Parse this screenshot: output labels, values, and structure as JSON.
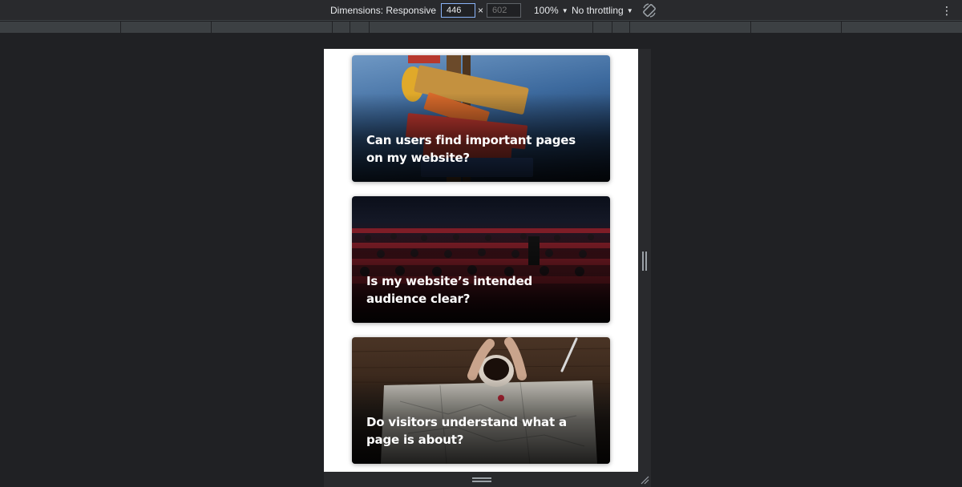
{
  "toolbar": {
    "dimensions_label": "Dimensions: Responsive",
    "width_value": "446",
    "times": "×",
    "height_placeholder": "602",
    "zoom": "100%",
    "throttling": "No throttling",
    "caret": "▼",
    "more": "⋮",
    "rotate_icon": "rotate-icon"
  },
  "colors": {
    "toolbar_bg": "#292a2d",
    "page_bg": "#202124",
    "viewport_bg": "#ffffff",
    "accent": "#8ab4f8"
  },
  "cards": [
    {
      "title": "Can users find important pages on my website?"
    },
    {
      "title": "Is my website’s intended audience clear?"
    },
    {
      "title": "Do visitors understand what a page is about?"
    }
  ]
}
